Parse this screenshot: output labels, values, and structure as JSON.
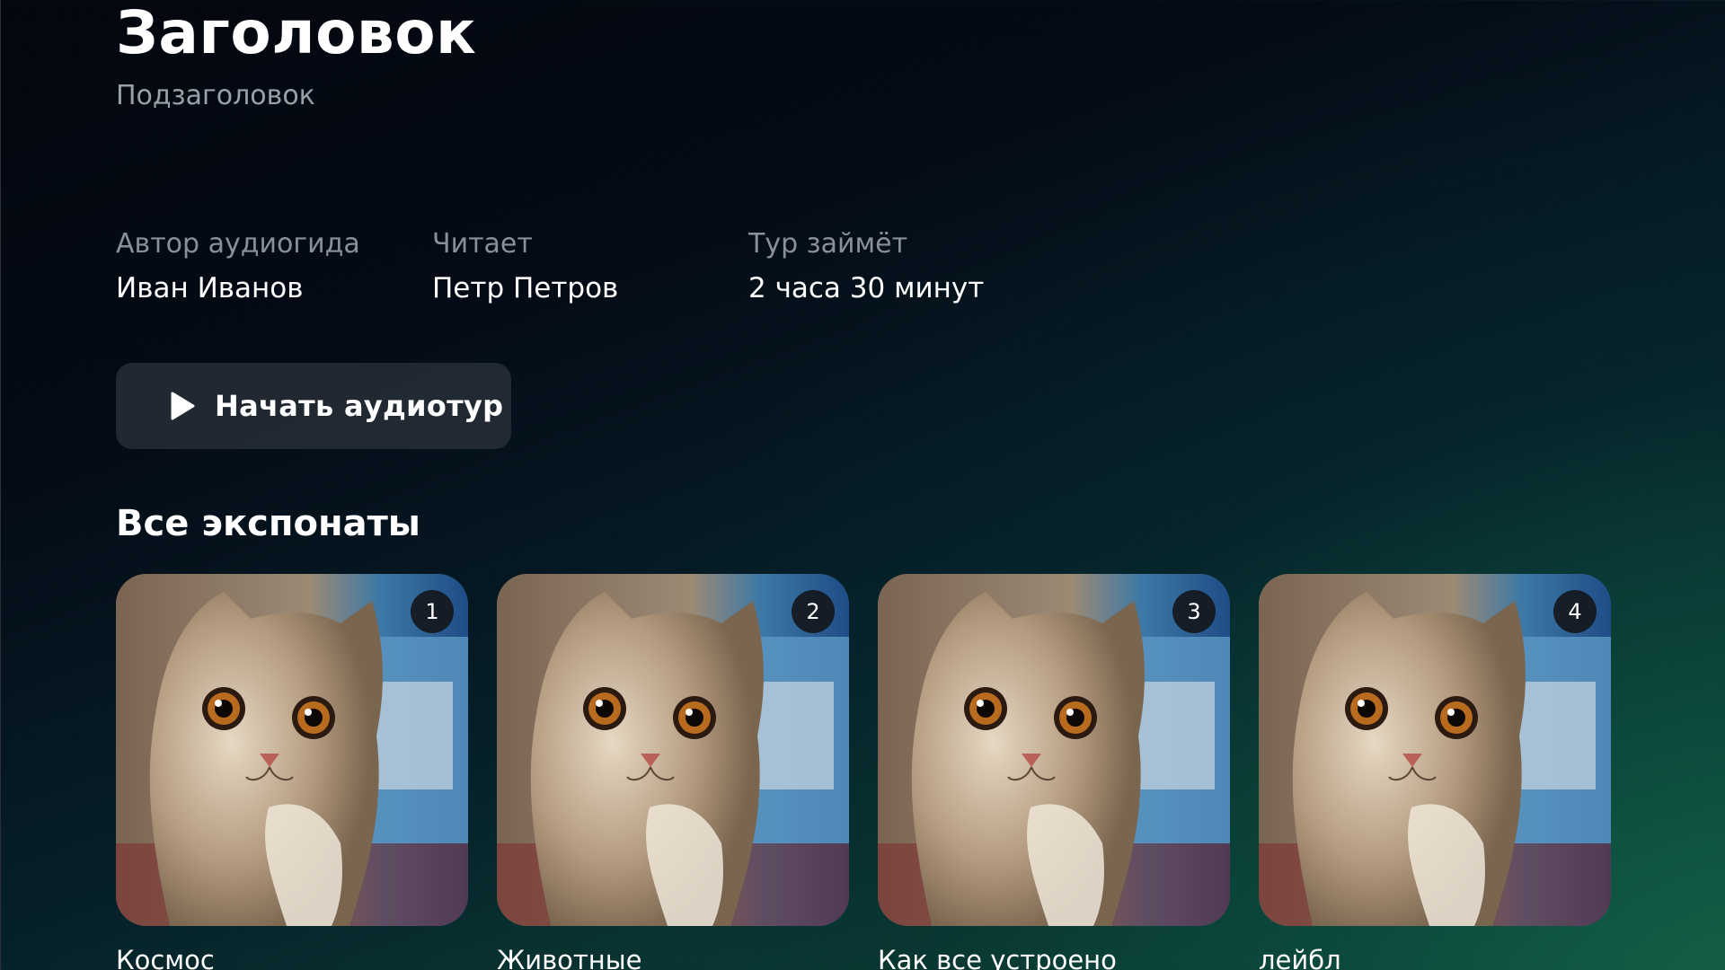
{
  "header": {
    "title": "Заголовок",
    "subtitle": "Подзаголовок"
  },
  "meta": [
    {
      "label": "Автор аудиогида",
      "value": "Иван Иванов"
    },
    {
      "label": "Читает",
      "value": "Петр Петров"
    },
    {
      "label": "Тур займёт",
      "value": "2 часа 30 минут"
    }
  ],
  "start_button": {
    "label": "Начать аудиотур",
    "icon": "play-icon"
  },
  "exhibits": {
    "title": "Все экспонаты",
    "items": [
      {
        "number": "1",
        "label": "Космос",
        "image": "cat-photo"
      },
      {
        "number": "2",
        "label": "Животные",
        "image": "cat-photo"
      },
      {
        "number": "3",
        "label": "Как все устроено",
        "image": "cat-photo"
      },
      {
        "number": "4",
        "label": "лейбл",
        "image": "cat-photo"
      }
    ]
  },
  "colors": {
    "background_top": "#03070f",
    "background_bottom": "#0f5642",
    "button_bg": "#343a42",
    "muted_text": "#8b9098"
  }
}
